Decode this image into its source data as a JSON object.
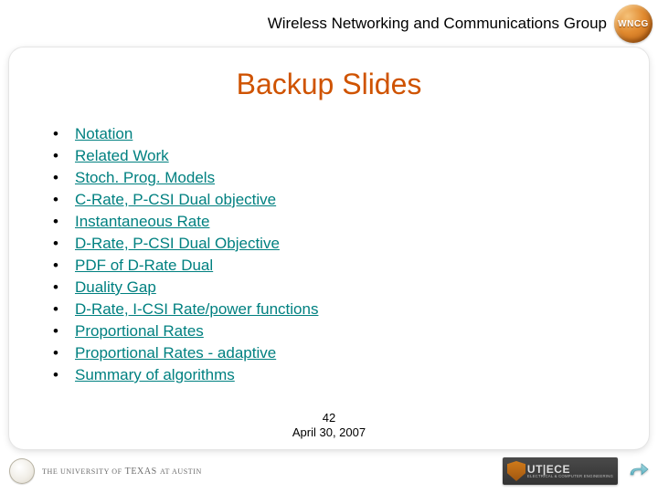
{
  "header": {
    "group_title": "Wireless Networking and Communications Group",
    "badge_text": "WNCG"
  },
  "slide": {
    "title": "Backup Slides"
  },
  "links": [
    "Notation",
    "Related Work",
    "Stoch. Prog. Models",
    "C-Rate, P-CSI Dual objective",
    "Instantaneous Rate",
    "D-Rate, P-CSI Dual Objective",
    "PDF of D-Rate Dual",
    "Duality Gap",
    "D-Rate, I-CSI Rate/power functions",
    "Proportional Rates",
    "Proportional Rates - adaptive",
    "Summary of algorithms"
  ],
  "page": {
    "number": "42",
    "date": "April 30, 2007"
  },
  "footer": {
    "ut_line1": "THE UNIVERSITY OF",
    "ut_line2": "TEXAS",
    "ut_line3": "AT AUSTIN",
    "utece_label": "UT|ECE",
    "utece_sub": "ELECTRICAL & COMPUTER ENGINEERING"
  },
  "colors": {
    "accent": "#cf5300",
    "link": "#008080"
  }
}
